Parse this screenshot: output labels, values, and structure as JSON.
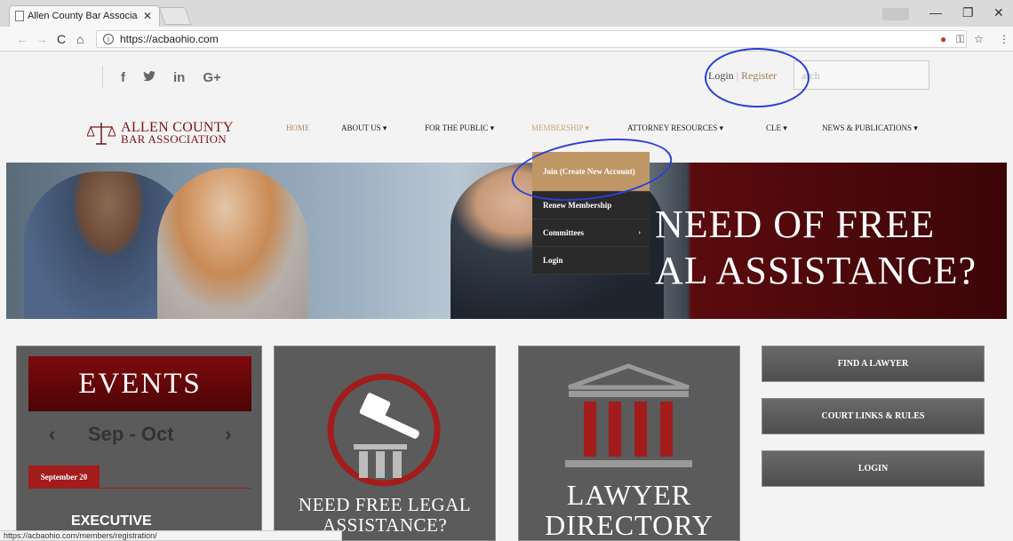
{
  "browser": {
    "tab_title": "Allen County Bar Associa",
    "tab_close": "✕",
    "url": "https://acbaohio.com",
    "win_min": "—",
    "win_max": "❐",
    "win_close": "✕",
    "status_url": "https://acbaohio.com/members/registration/"
  },
  "header": {
    "social": [
      "f",
      "🐦",
      "in",
      "G+"
    ],
    "login": "Login",
    "separator": "|",
    "register": "Register",
    "search_placeholder": "arch"
  },
  "logo": {
    "line1": "ALLEN COUNTY",
    "line2": "BAR ASSOCIATION"
  },
  "nav": {
    "items": [
      "HOME",
      "ABOUT US ▾",
      "FOR THE PUBLIC ▾",
      "MEMBERSHIP ▾",
      "ATTORNEY RESOURCES ▾",
      "CLE ▾",
      "NEWS & PUBLICATIONS ▾"
    ]
  },
  "dropdown": {
    "items": [
      "Join (Create New Account)",
      "Renew Membership",
      "Committees",
      "Login"
    ],
    "caret": "›"
  },
  "hero": {
    "line1": "NEED OF FREE",
    "line2": "AL ASSISTANCE?"
  },
  "events": {
    "title": "EVENTS",
    "prev": "‹",
    "month": "Sep - Oct",
    "next": "›",
    "date": "September 20",
    "event_title": "EXECUTIVE"
  },
  "legal": {
    "line1": "NEED FREE LEGAL",
    "line2": "ASSISTANCE?"
  },
  "directory": {
    "line1": "LAWYER",
    "line2": "DIRECTORY"
  },
  "side_buttons": [
    "FIND A LAWYER",
    "COURT LINKS & RULES",
    "LOGIN"
  ],
  "colors": {
    "brand_red": "#7a1416",
    "gold": "#bf9766",
    "annotation_blue": "#2a3fd6"
  }
}
